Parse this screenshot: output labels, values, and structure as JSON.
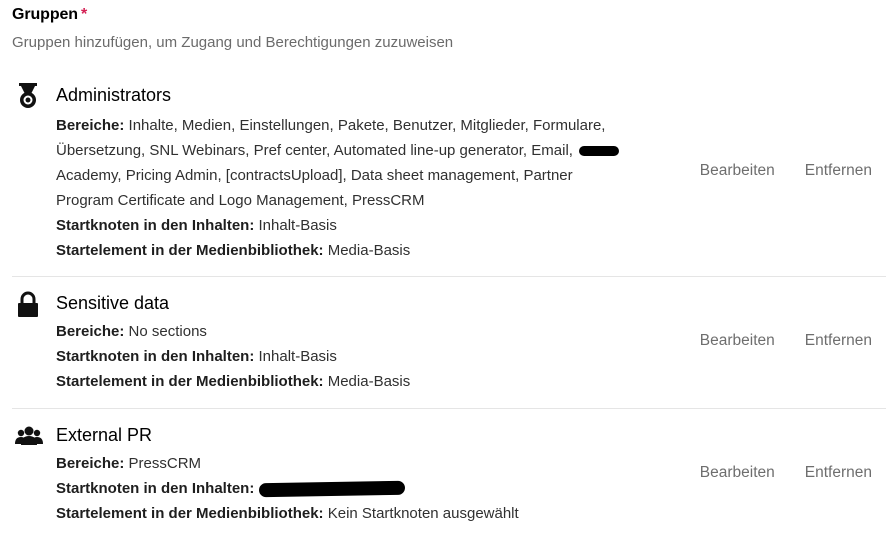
{
  "header": {
    "title": "Gruppen",
    "required_mark": "*",
    "description": "Gruppen hinzufügen, um Zugang und Berechtigungen zuzuweisen"
  },
  "labels": {
    "sections": "Bereiche:",
    "content_start": "Startknoten in den Inhalten:",
    "media_start": "Startelement in der Medienbibliothek:"
  },
  "actions": {
    "edit": "Bearbeiten",
    "remove": "Entfernen"
  },
  "groups": [
    {
      "name": "Administrators",
      "icon": "medal-icon",
      "sections_line1": "Inhalte, Medien, Einstellungen, Pakete, Benutzer, Mitglieder, Formulare,",
      "sections_line2": "Übersetzung, SNL Webinars, Pref center, Automated line-up generator, Email,",
      "sections_line3": "Academy, Pricing Admin, [contractsUpload], Data sheet management, Partner",
      "sections_line4": "Program Certificate and Logo Management, PressCRM",
      "content_start": "Inhalt-Basis",
      "media_start": "Media-Basis"
    },
    {
      "name": "Sensitive data",
      "icon": "lock-icon",
      "sections": "No sections",
      "content_start": "Inhalt-Basis",
      "media_start": "Media-Basis"
    },
    {
      "name": "External PR",
      "icon": "users-icon",
      "sections": "PressCRM",
      "content_start": "",
      "media_start": "Kein Startknoten ausgewählt"
    }
  ]
}
